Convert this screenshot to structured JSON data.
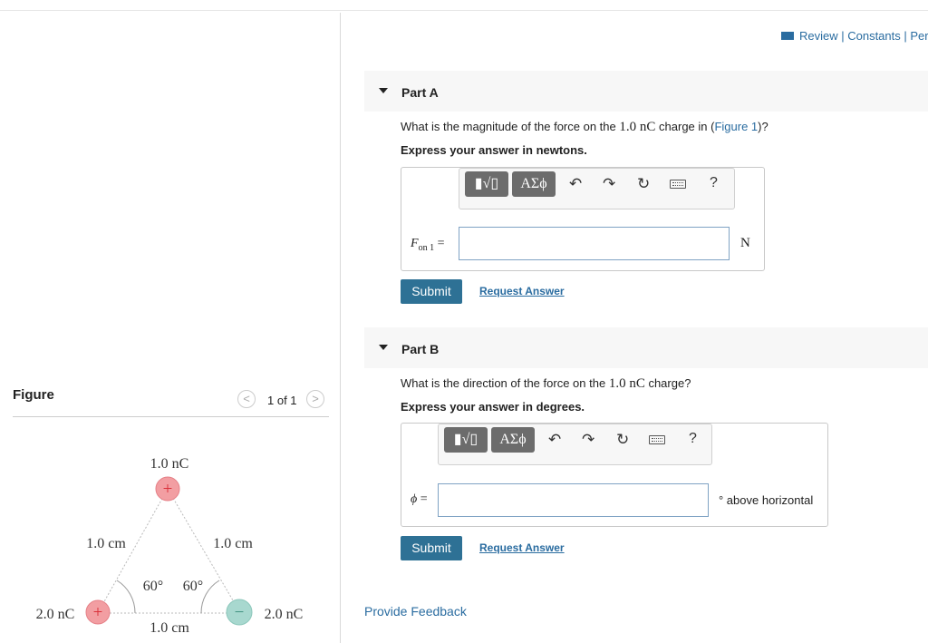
{
  "header": {
    "links": "Review | Constants | Peri"
  },
  "figure_panel": {
    "title": "Figure",
    "pager": "1 of 1",
    "prev_icon": "chevron-left-icon",
    "next_icon": "chevron-right-icon",
    "diagram": {
      "top_charge": "1.0 nC",
      "left_charge": "2.0 nC",
      "right_charge": "2.0 nC",
      "left_side": "1.0 cm",
      "right_side": "1.0 cm",
      "bottom_side": "1.0 cm",
      "angle_left": "60°",
      "angle_right": "60°",
      "plus_sign": "+",
      "minus_sign": "−",
      "colors": {
        "positive": "#f29ea2",
        "negative": "#a8d8cf",
        "plus": "#d9303a",
        "minus": "#3c8f7d"
      }
    }
  },
  "part_a": {
    "label": "Part A",
    "question_pre": "What is the magnitude of the force on the",
    "question_value": "1.0 nC",
    "question_mid": "charge in (",
    "figure_link": "Figure 1",
    "question_post": ")?",
    "instruction": "Express your answer in newtons.",
    "variable_main": "F",
    "variable_sub": "on 1",
    "equals": "=",
    "input_value": "",
    "unit": "N",
    "submit_label": "Submit",
    "request_label": "Request Answer"
  },
  "part_b": {
    "label": "Part B",
    "question_pre": "What is the direction of the force on the",
    "question_value": "1.0 nC",
    "question_post": "charge?",
    "instruction": "Express your answer in degrees.",
    "variable": "ϕ",
    "equals": "=",
    "input_value": "",
    "unit": "° above horizontal",
    "submit_label": "Submit",
    "request_label": "Request Answer"
  },
  "toolbar": {
    "templates_label": "▮√▯",
    "symbols_label": "ΑΣϕ",
    "help_label": "?",
    "icons": [
      "templates-icon",
      "greek-symbols-icon",
      "undo-icon",
      "redo-icon",
      "reset-icon",
      "keyboard-icon",
      "help-icon"
    ]
  },
  "footer": {
    "feedback": "Provide Feedback"
  }
}
